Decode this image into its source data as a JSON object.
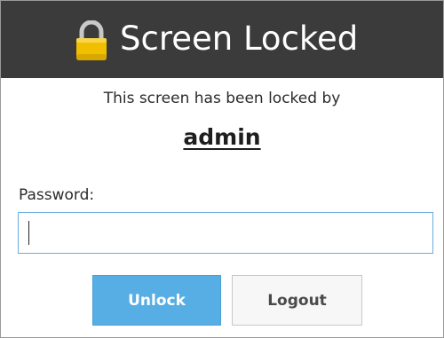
{
  "titlebar": {
    "title": "Screen Locked",
    "icon": "lock-icon"
  },
  "message": {
    "text": "This screen has been locked by",
    "username": "admin"
  },
  "password": {
    "label": "Password:",
    "value": "",
    "placeholder": ""
  },
  "buttons": {
    "unlock_label": "Unlock",
    "logout_label": "Logout"
  },
  "colors": {
    "titlebar_bg": "#3b3b3b",
    "accent": "#57aee4",
    "lock_icon": "#f0c000"
  }
}
